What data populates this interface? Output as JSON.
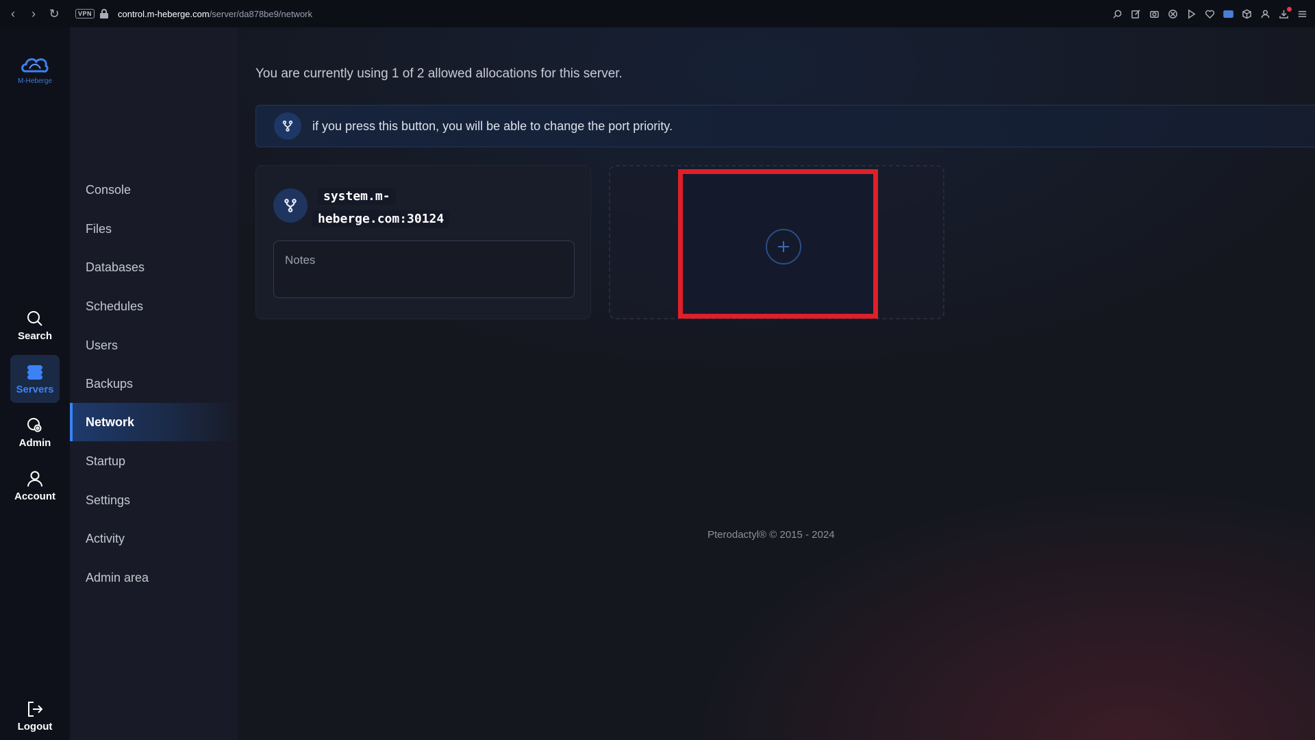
{
  "browser": {
    "vpn_label": "VPN",
    "url_host": "control.m-heberge.com",
    "url_path": "/server/da878be9/network"
  },
  "brand": {
    "logo_text": "M-Heberge"
  },
  "rail": {
    "search": "Search",
    "servers": "Servers",
    "admin": "Admin",
    "account": "Account",
    "logout": "Logout"
  },
  "subnav": {
    "items": [
      "Console",
      "Files",
      "Databases",
      "Schedules",
      "Users",
      "Backups",
      "Network",
      "Startup",
      "Settings",
      "Activity",
      "Admin area"
    ],
    "active": "Network"
  },
  "main": {
    "allocation_text": "You are currently using 1 of 2 allowed allocations for this server.",
    "info_text": "if you press this button, you will be able to change the port priority.",
    "allocation": {
      "address_line1": "system.m-",
      "address_line2": "heberge.com:30124",
      "notes_placeholder": "Notes"
    }
  },
  "footer": {
    "text": "Pterodactyl® © 2015 - 2024"
  },
  "colors": {
    "accent": "#3b82f6",
    "highlight": "#e01f2a",
    "background": "#15171f"
  }
}
